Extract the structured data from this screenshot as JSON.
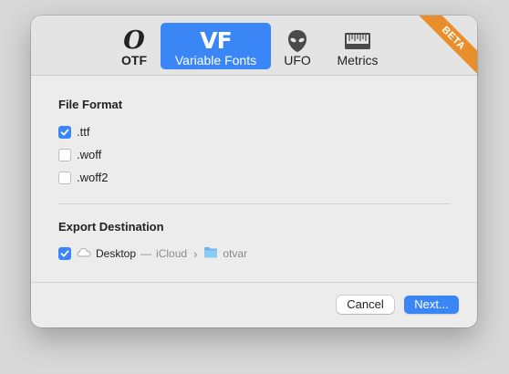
{
  "toolbar": {
    "tabs": [
      {
        "label": "OTF",
        "icon": "otf-glyph-icon",
        "glyph": "O"
      },
      {
        "label": "Variable Fonts",
        "icon": "vf-glyph-icon",
        "glyph": "VF",
        "active": true
      },
      {
        "label": "UFO",
        "icon": "alien-head-icon"
      },
      {
        "label": "Metrics",
        "icon": "ruler-icon"
      }
    ]
  },
  "ribbon": {
    "text": "BETA",
    "color": "#e88f2c"
  },
  "file_format": {
    "title": "File Format",
    "options": [
      {
        "label": ".ttf",
        "checked": true
      },
      {
        "label": ".woff",
        "checked": false
      },
      {
        "label": ".woff2",
        "checked": false
      }
    ]
  },
  "export_destination": {
    "title": "Export Destination",
    "checked": true,
    "location": "Desktop",
    "separator": "—",
    "service": "iCloud",
    "folder": "otvar"
  },
  "buttons": {
    "cancel": "Cancel",
    "next": "Next..."
  },
  "colors": {
    "accent": "#3b86f7",
    "ribbon": "#e88f2c"
  }
}
